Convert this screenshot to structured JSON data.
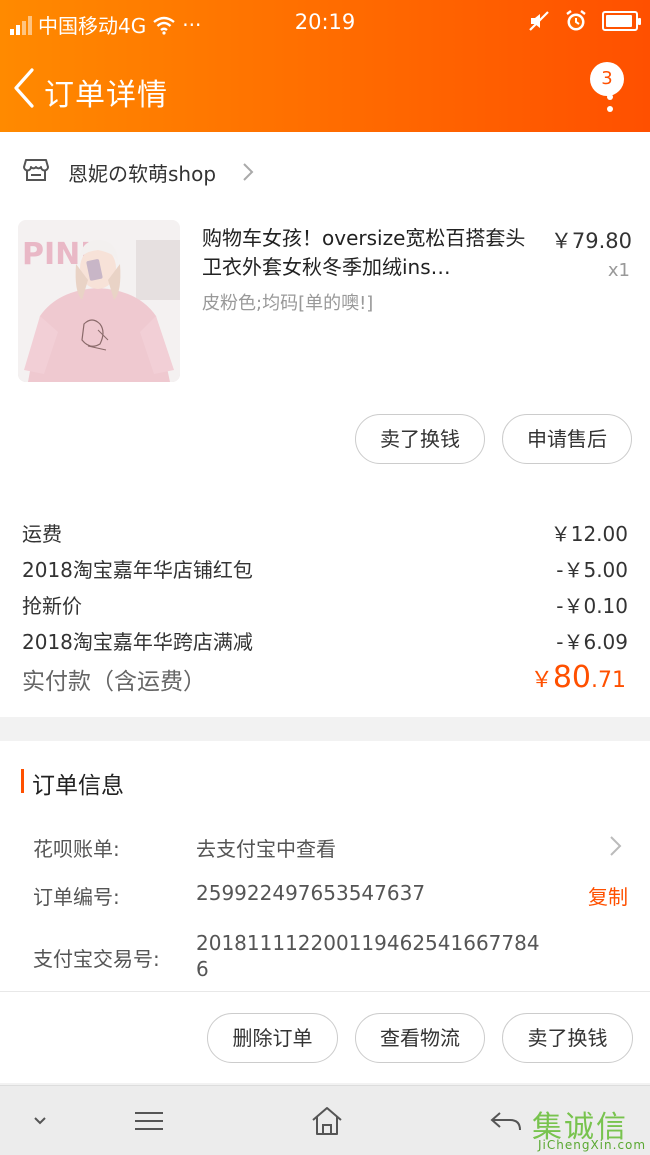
{
  "status_bar": {
    "carrier": "中国移动4G",
    "dots": "···",
    "time": "20:19"
  },
  "nav": {
    "title": "订单详情",
    "badge_count": "3"
  },
  "shop": {
    "name": "恩妮の软萌shop"
  },
  "item": {
    "image_text": "PINK",
    "title": "购物车女孩！oversize宽松百搭套头卫衣外套女秋冬季加绒ins…",
    "sku": "皮粉色;均码[单的噢!]",
    "price": "￥79.80",
    "qty": "x1",
    "actions": [
      "卖了换钱",
      "申请售后"
    ]
  },
  "fees": [
    {
      "label": "运费",
      "value": "￥12.00"
    },
    {
      "label": "2018淘宝嘉年华店铺红包",
      "value": "-￥5.00"
    },
    {
      "label": "抢新价",
      "value": "-￥0.10"
    },
    {
      "label": "2018淘宝嘉年华跨店满减",
      "value": "-￥6.09"
    }
  ],
  "paid": {
    "label": "实付款（含运费）",
    "currency": "￥",
    "integer": "80",
    "decimal": ".71"
  },
  "order_info": {
    "title": "订单信息",
    "huabei_label": "花呗账单:",
    "huabei_value": "去支付宝中查看",
    "order_no_label": "订单编号:",
    "order_no_value": "259922497653547637",
    "copy_label": "复制",
    "alipay_label": "支付宝交易号:",
    "alipay_value_line1": "201811112200119462541667784",
    "alipay_value_line2": "6"
  },
  "bottom_actions": [
    "删除订单",
    "查看物流",
    "卖了换钱"
  ],
  "watermark": {
    "chars": "集诚信",
    "sub": "JiChengXin.com"
  },
  "colors": {
    "accent": "#ff5000",
    "header_start": "#ff8a00",
    "header_end": "#ff5000"
  }
}
